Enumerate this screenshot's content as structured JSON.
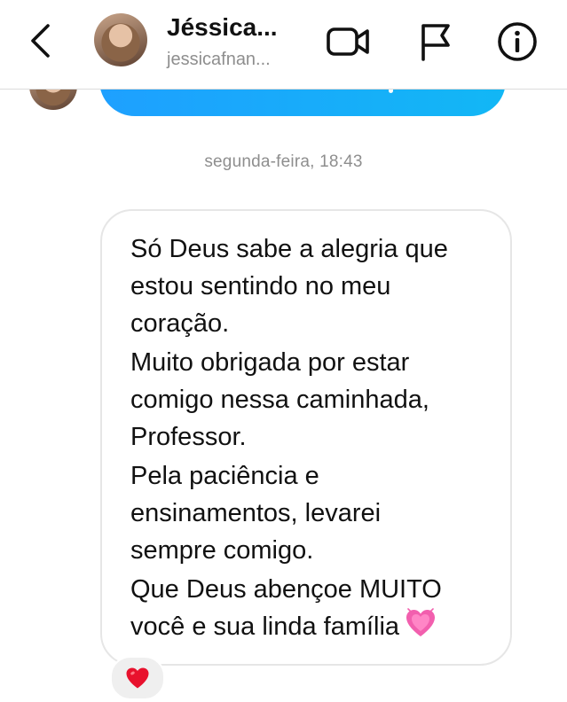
{
  "header": {
    "contact_name": "Jéssica...",
    "contact_username": "jessicafnan...",
    "icons": {
      "back": "chevron-left-icon",
      "video": "video-camera-icon",
      "flag": "flag-icon",
      "info": "info-icon"
    }
  },
  "chat": {
    "timestamp": "segunda-feira, 18:43",
    "message": {
      "paragraphs": [
        [
          "Só Deus sabe a alegria que",
          "estou sentindo no meu",
          "coração."
        ],
        [
          "Muito obrigada por estar",
          "comigo nessa caminhada,",
          "Professor."
        ],
        [
          "Pela paciência e",
          "ensinamentos, levarei",
          "sempre comigo."
        ],
        [
          "Que Deus abençoe MUITO",
          "você e sua linda família"
        ]
      ],
      "trailing_emoji": "growing-heart-emoji",
      "reaction": "red-heart-emoji"
    }
  },
  "colors": {
    "sent_bubble_start": "#1ea0ff",
    "sent_bubble_end": "#12b7f5",
    "timestamp": "#8e8e8e",
    "username": "#8e8e8e",
    "bubble_border": "#e6e6e6"
  }
}
